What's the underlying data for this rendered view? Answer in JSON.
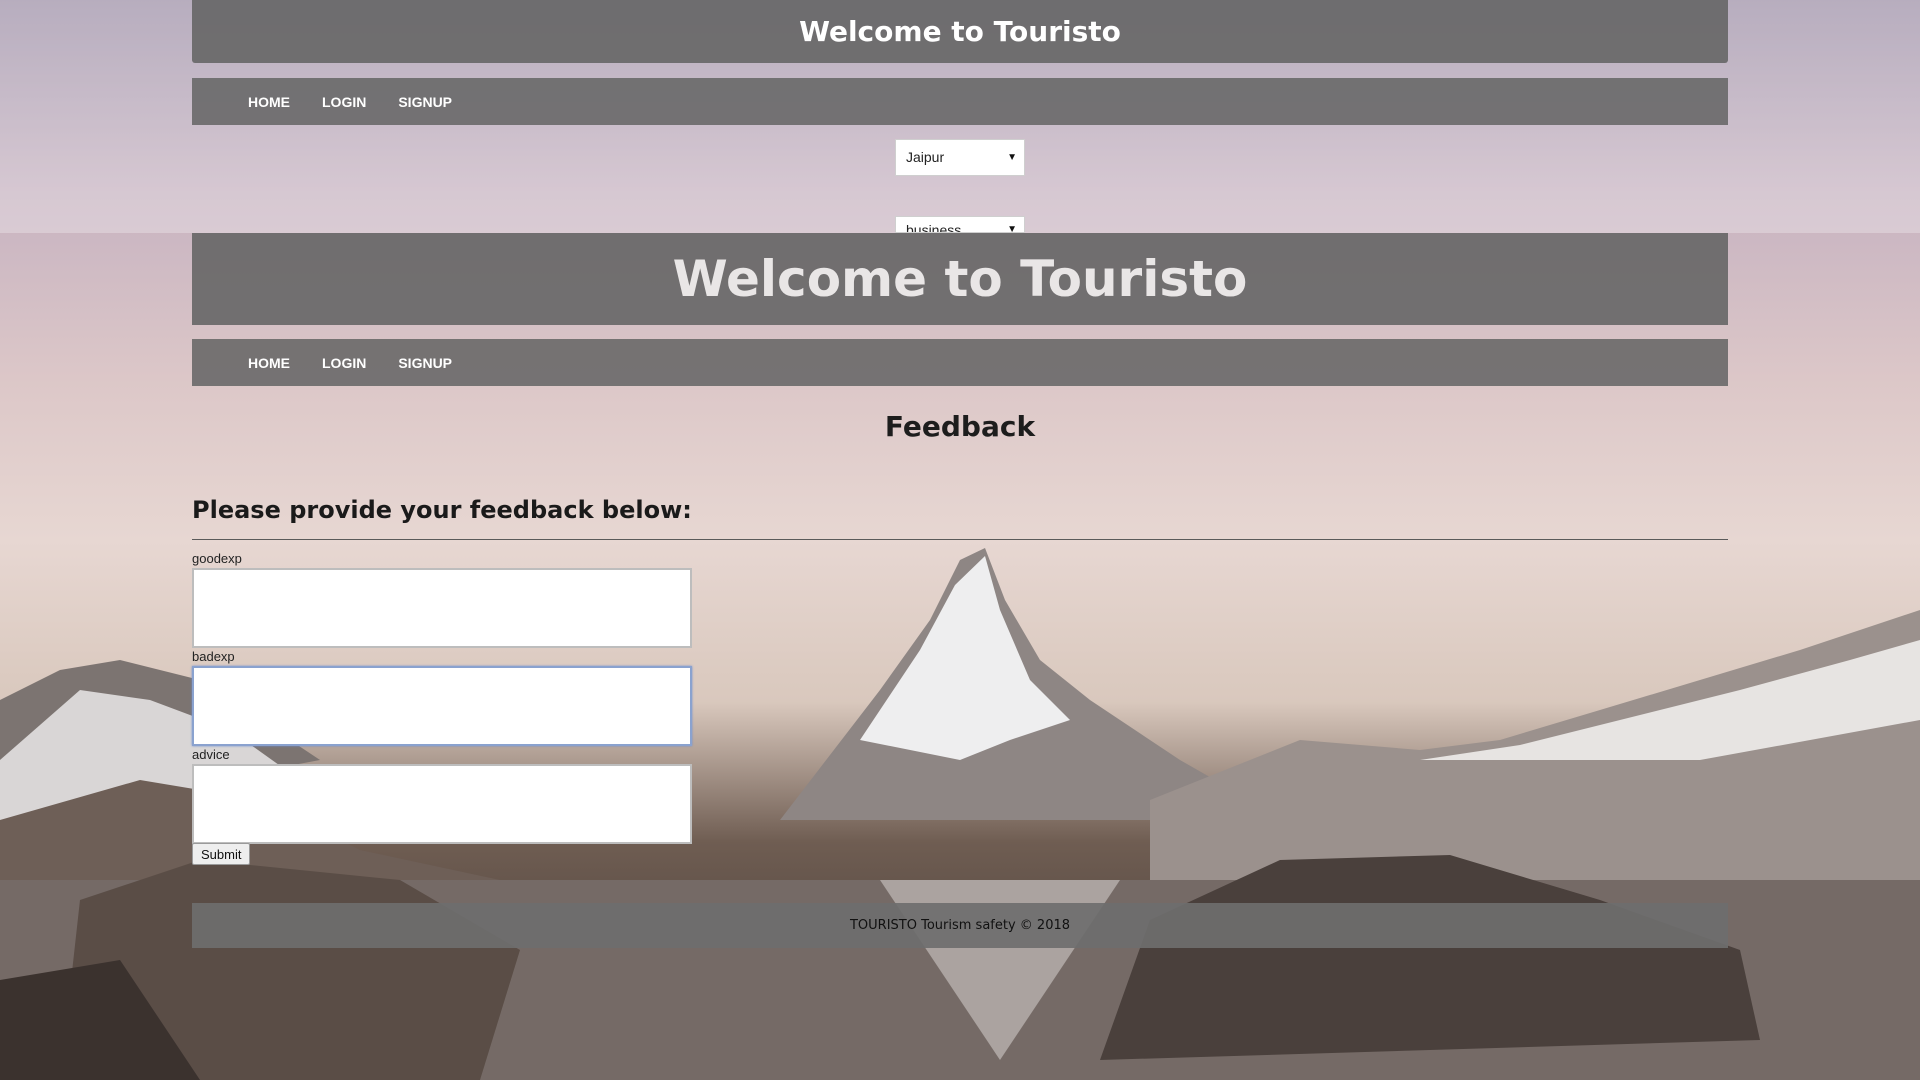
{
  "site_title": "Welcome to Touristo",
  "nav": {
    "items": [
      "HOME",
      "LOGIN",
      "SIGNUP"
    ]
  },
  "ghost": {
    "city_select": "Jaipur",
    "category_select": "business"
  },
  "main": {
    "page_title": "Feedback",
    "form_heading": "Please provide your feedback below:",
    "fields": [
      {
        "label": "goodexp",
        "value": ""
      },
      {
        "label": "badexp",
        "value": ""
      },
      {
        "label": "advice",
        "value": ""
      }
    ],
    "submit_label": "Submit"
  },
  "footer": {
    "text": "TOURISTO Tourism safety © 2018"
  },
  "colors": {
    "header_bg": "#666666",
    "nav_text": "#ffffff",
    "focus_border": "#8aa2cf"
  }
}
